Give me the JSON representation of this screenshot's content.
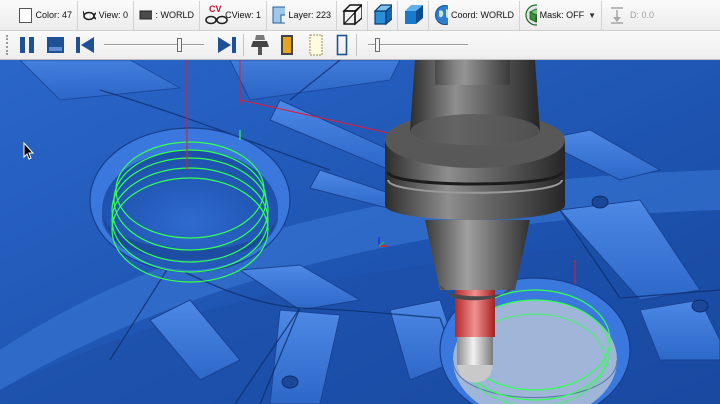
{
  "toolbar": {
    "color_label": "Color: 47",
    "view_label": "View: 0",
    "world_label": ": WORLD",
    "cview_label": "CView: 1",
    "cv_badge": "CV",
    "layer_label": "Layer: 223",
    "coord_label": "Coord: WORLD",
    "mask_label": "Mask: OFF",
    "d_label": "D: 0.0"
  },
  "playback": {
    "speed_slider_level": 0.75,
    "step_slider_level": 0.08
  },
  "icons": {
    "color": "square-swatch-icon",
    "view": "glasses-icon",
    "world": "arrow-right-icon",
    "cview": "cv-glasses-icon",
    "layer": "layer-icon",
    "wire": "wireframe-cube-icon",
    "shaded_wire": "shaded-wire-cube-icon",
    "shaded": "shaded-cube-icon",
    "coord": "globe-icon",
    "mask": "mask-cube-icon",
    "d": "depth-arrow-icon",
    "pause": "pause-icon",
    "stop": "stop-icon",
    "rewind": "skip-back-icon",
    "forward": "skip-forward-icon",
    "tool": "tool-holder-icon",
    "holder": "holder-icon",
    "stock": "stock-icon",
    "frame": "frame-icon"
  },
  "colors": {
    "part_blue": "#1f5cc4",
    "toolpath_green": "#33ff55",
    "rapid_red": "#d8203a",
    "tool_red": "#e05a5a",
    "holder_gray": "#6e6e6e"
  }
}
